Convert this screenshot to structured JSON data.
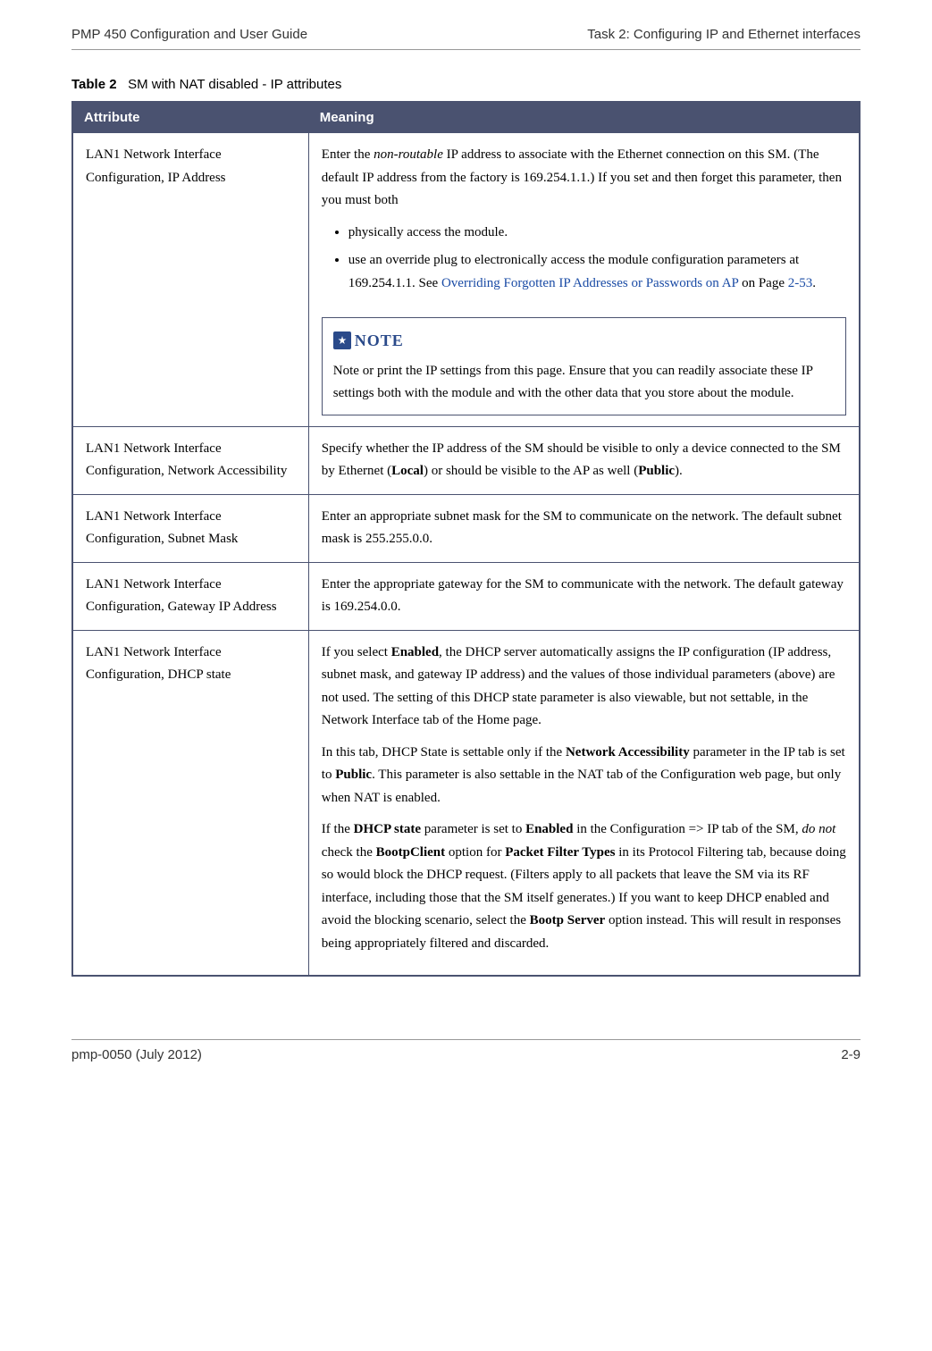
{
  "header": {
    "left": "PMP 450 Configuration and User Guide",
    "right": "Task 2: Configuring IP and Ethernet interfaces"
  },
  "table": {
    "caption_num": "Table 2",
    "caption_text": "SM with NAT disabled - IP attributes",
    "headers": {
      "attribute": "Attribute",
      "meaning": "Meaning"
    },
    "rows": [
      {
        "attribute": "LAN1 Network Interface Configuration, IP Address",
        "meaning": {
          "intro_pre": "Enter the ",
          "intro_italic": "non-routable",
          "intro_post": " IP address to associate with the Ethernet connection on this SM. (The default IP address from the factory is 169.254.1.1.) If you set and then forget this parameter, then you must both",
          "bullets": [
            {
              "text": "physically access the module."
            },
            {
              "pre": "use an override plug to electronically access the module configuration parameters at 169.254.1.1. See ",
              "link": "Overriding Forgotten IP Addresses or Passwords on AP",
              "mid": " on Page ",
              "pageref": "2-53",
              "post": "."
            }
          ],
          "note_label": "NOTE",
          "note_body": "Note or print the IP settings from this page. Ensure that you can readily associate these IP settings both with the module and with the other data that you store about the module."
        }
      },
      {
        "attribute": "LAN1 Network Interface Configuration, Network Accessibility",
        "plain_pre": "Specify whether the IP address of the SM should be visible to only a device connected to the SM by Ethernet (",
        "bold1": "Local",
        "plain_mid": ") or should be visible to the AP as well (",
        "bold2": "Public",
        "plain_post": ")."
      },
      {
        "attribute": "LAN1 Network Interface Configuration, Subnet Mask",
        "plain": "Enter an appropriate subnet mask for the SM to communicate on the network. The default subnet mask is 255.255.0.0."
      },
      {
        "attribute": "LAN1 Network Interface Configuration, Gateway IP Address",
        "plain": "Enter the appropriate gateway for the SM to communicate with the network. The default gateway is 169.254.0.0."
      },
      {
        "attribute": "LAN1 Network Interface Configuration, DHCP state",
        "p1_pre": "If you select ",
        "p1_b1": "Enabled",
        "p1_post": ", the DHCP server automatically assigns the IP configuration (IP address, subnet mask, and gateway IP address) and the values of those individual parameters (above) are not used. The setting of this DHCP state parameter is also viewable, but not settable, in the Network Interface tab of the Home page.",
        "p2_pre": "In this tab, DHCP State is settable only if the ",
        "p2_b1": "Network Accessibility",
        "p2_mid": " parameter in the IP tab is set to ",
        "p2_b2": "Public",
        "p2_post": ". This parameter is also settable in the NAT tab of the Configuration web page, but only when NAT is enabled.",
        "p3_pre": "If the ",
        "p3_b1": "DHCP state",
        "p3_mid1": " parameter is set to ",
        "p3_b2": "Enabled",
        "p3_mid2": " in the Configuration => IP tab of the SM, ",
        "p3_i1": "do not",
        "p3_mid3": " check the ",
        "p3_b3": "BootpClient",
        "p3_mid4": " option for ",
        "p3_b4": "Packet Filter Types",
        "p3_mid5": " in its Protocol Filtering tab, because doing so would block the DHCP request. (Filters apply to all packets that leave the SM via its RF interface, including those that the SM itself generates.) If you want to keep DHCP enabled and avoid the blocking scenario, select the ",
        "p3_b5": "Bootp Server",
        "p3_post": " option instead. This will result in responses being appropriately filtered and discarded."
      }
    ]
  },
  "footer": {
    "left": "pmp-0050 (July 2012)",
    "right": "2-9"
  }
}
